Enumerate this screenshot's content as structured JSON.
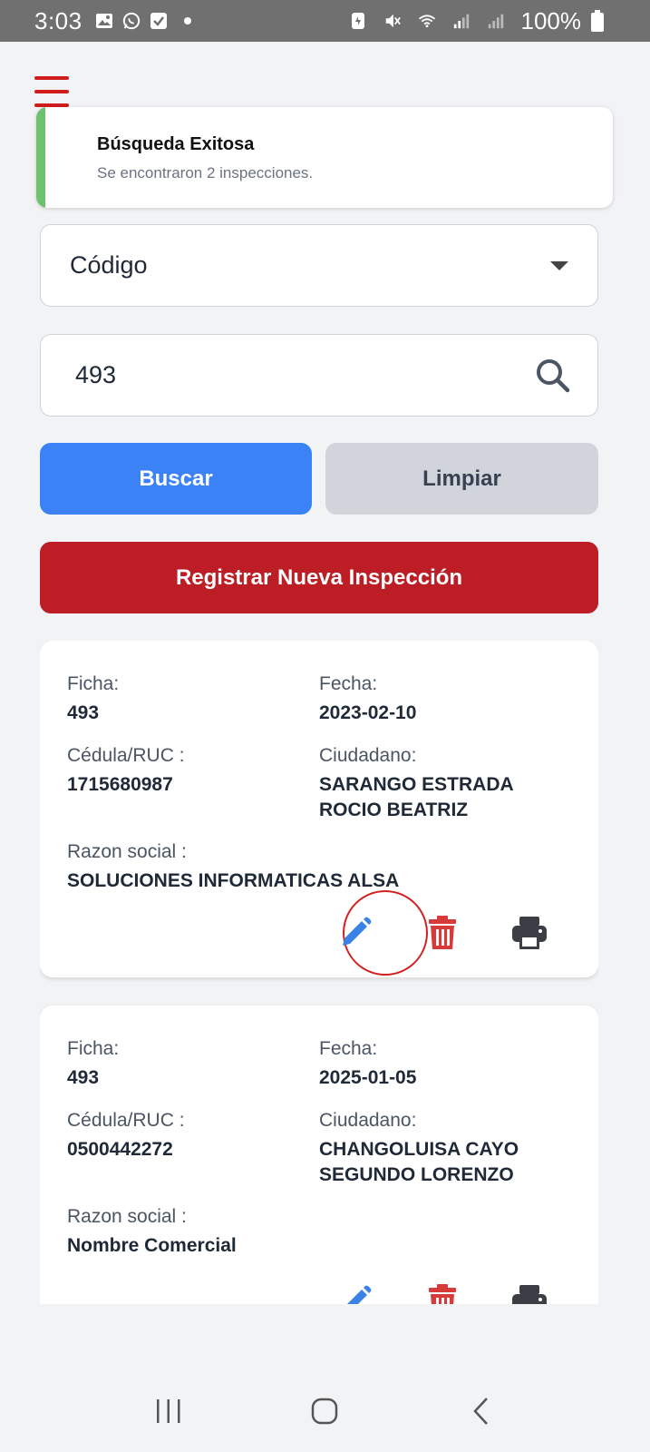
{
  "status_bar": {
    "time": "3:03",
    "battery": "100%",
    "icons": [
      "gallery-icon",
      "whatsapp-icon",
      "checkbox-icon",
      "dot-icon",
      "battery-saver-icon",
      "mute-icon",
      "wifi-icon",
      "signal-icon",
      "signal-icon",
      "battery-icon"
    ]
  },
  "menu": {
    "icon": "hamburger-icon",
    "color": "#d11c1c"
  },
  "toast": {
    "title": "Búsqueda Exitosa",
    "message": "Se encontraron 2 inspecciones.",
    "accent": "#6cc26e"
  },
  "filter": {
    "selected": "Código",
    "icon": "caret-down-icon"
  },
  "search": {
    "value": "493",
    "icon": "search-icon"
  },
  "buttons": {
    "buscar": "Buscar",
    "limpiar": "Limpiar",
    "registrar": "Registrar Nueva Inspección"
  },
  "colors": {
    "primary": "#3b82f6",
    "danger": "#bd1d24",
    "secondary": "#d1d5db",
    "edit": "#3b82e6",
    "delete": "#d63a3a",
    "print": "#3b3f45"
  },
  "labels": {
    "ficha": "Ficha:",
    "fecha": "Fecha:",
    "cedula": "Cédula/RUC :",
    "ciudadano": "Ciudadano:",
    "razon": "Razon social :"
  },
  "inspections": [
    {
      "ficha": "493",
      "fecha": "2023-02-10",
      "cedula": "1715680987",
      "ciudadano_line1": "SARANGO ESTRADA",
      "ciudadano_line2": "ROCIO BEATRIZ",
      "razon": "SOLUCIONES INFORMATICAS ALSA",
      "actions": [
        "edit-icon",
        "delete-icon",
        "print-icon"
      ]
    },
    {
      "ficha": "493",
      "fecha": "2025-01-05",
      "cedula": "0500442272",
      "ciudadano_line1": "CHANGOLUISA CAYO",
      "ciudadano_line2": "SEGUNDO LORENZO",
      "razon": "Nombre Comercial",
      "actions": [
        "edit-icon",
        "delete-icon",
        "print-icon"
      ]
    }
  ],
  "nav_bar": [
    "recents-icon",
    "home-icon",
    "back-icon"
  ]
}
